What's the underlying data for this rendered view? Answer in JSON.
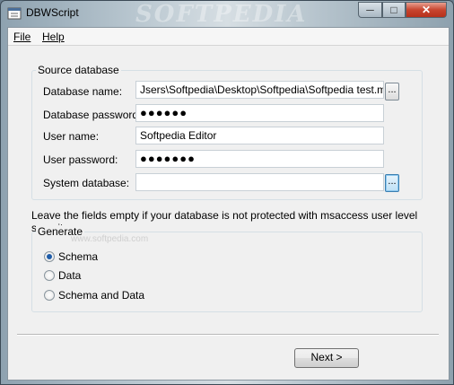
{
  "window": {
    "title": "DBWScript",
    "watermark": "SOFTPEDIA",
    "minimize_glyph": "─",
    "maximize_glyph": "□",
    "close_glyph": "✕"
  },
  "menu": {
    "file": "File",
    "help": "Help"
  },
  "source": {
    "legend": "Source database",
    "db_name_label": "Database name:",
    "db_name_value": "Jsers\\Softpedia\\Desktop\\Softpedia\\Softpedia test.mdb",
    "db_password_label": "Database password:",
    "db_password_value": "●●●●●●",
    "user_name_label": "User name:",
    "user_name_value": "Softpedia Editor",
    "user_password_label": "User password:",
    "user_password_value": "●●●●●●●",
    "system_db_label": "System database:",
    "system_db_value": "",
    "browse_label": "..."
  },
  "note": "Leave the fields empty if your database is not protected with msaccess user level security.",
  "generate": {
    "legend": "Generate",
    "watermark": "www.softpedia.com",
    "options": [
      "Schema",
      "Data",
      "Schema and Data"
    ],
    "selected": "Schema"
  },
  "buttons": {
    "next": "Next >"
  }
}
